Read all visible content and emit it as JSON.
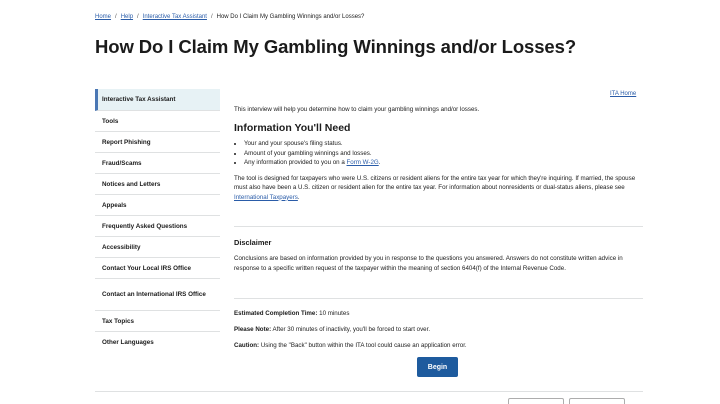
{
  "breadcrumb": {
    "items": [
      "Home",
      "Help",
      "Interactive Tax Assistant"
    ],
    "current": "How Do I Claim My Gambling Winnings and/or Losses?",
    "separator": "/"
  },
  "page": {
    "title": "How Do I Claim My Gambling Winnings and/or Losses?"
  },
  "sidebar": {
    "items": [
      {
        "label": "Interactive Tax Assistant",
        "active": true
      },
      {
        "label": "Tools"
      },
      {
        "label": "Report Phishing"
      },
      {
        "label": "Fraud/Scams"
      },
      {
        "label": "Notices and Letters"
      },
      {
        "label": "Appeals"
      },
      {
        "label": "Frequently Asked Questions"
      },
      {
        "label": "Accessibility"
      },
      {
        "label": "Contact Your Local IRS Office"
      },
      {
        "label": "Contact an International IRS Office"
      },
      {
        "label": "Tax Topics"
      },
      {
        "label": "Other Languages"
      }
    ]
  },
  "main": {
    "ita_home_link": "ITA Home",
    "intro": "This interview will help you determine how to claim your gambling winnings and/or losses.",
    "info_heading": "Information You'll Need",
    "needs": {
      "item1": "Your and your spouse's filing status.",
      "item2": "Amount of your gambling winnings and losses.",
      "item3_prefix": "Any information provided to you on a ",
      "item3_link": "Form W-2G",
      "item3_suffix": "."
    },
    "eligibility": {
      "text": "The tool is designed for taxpayers who were U.S. citizens or resident aliens for the entire tax year for which they're inquiring. If married, the spouse must also have been a U.S. citizen or resident alien for the entire tax year. For information about nonresidents or dual-status aliens, please see ",
      "link": "International Taxpayers",
      "suffix": "."
    },
    "disclaimer_heading": "Disclaimer",
    "disclaimer_text": "Conclusions are based on information provided by you in response to the questions you answered. Answers do not constitute written advice in response to a specific written request of the taxpayer within the meaning of section 6404(f) of the Internal Revenue Code.",
    "completion_label": "Estimated Completion Time:",
    "completion_value": " 10 minutes",
    "note_label": "Please Note:",
    "note_value": " After 30 minutes of inactivity, you'll be forced to start over.",
    "caution_label": "Caution:",
    "caution_value": " Using the \"Back\" button within the ITA tool could cause an application error.",
    "begin_label": "Begin"
  }
}
